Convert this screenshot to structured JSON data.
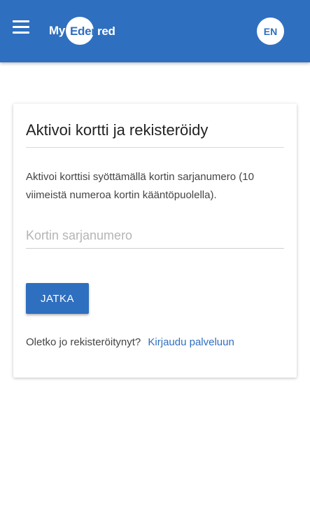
{
  "header": {
    "menu_icon": "hamburger-menu-icon",
    "logo_prefix": "My",
    "logo_brand": "Edenred",
    "language_label": "EN",
    "background_color": "#2f6fbf"
  },
  "card": {
    "title": "Aktivoi kortti ja rekisteröidy",
    "description": "Aktivoi korttisi syöttämällä kortin sarjanumero (10 viimeistä numeroa kortin kääntöpuolella).",
    "serial_input": {
      "placeholder": "Kortin sarjanumero",
      "value": ""
    },
    "continue_label": "JATKA",
    "login_prompt": "Oletko jo rekisteröitynyt?",
    "login_link": "Kirjaudu palveluun"
  },
  "colors": {
    "accent": "#2f6fbf",
    "logo_red": "#e2001a"
  }
}
